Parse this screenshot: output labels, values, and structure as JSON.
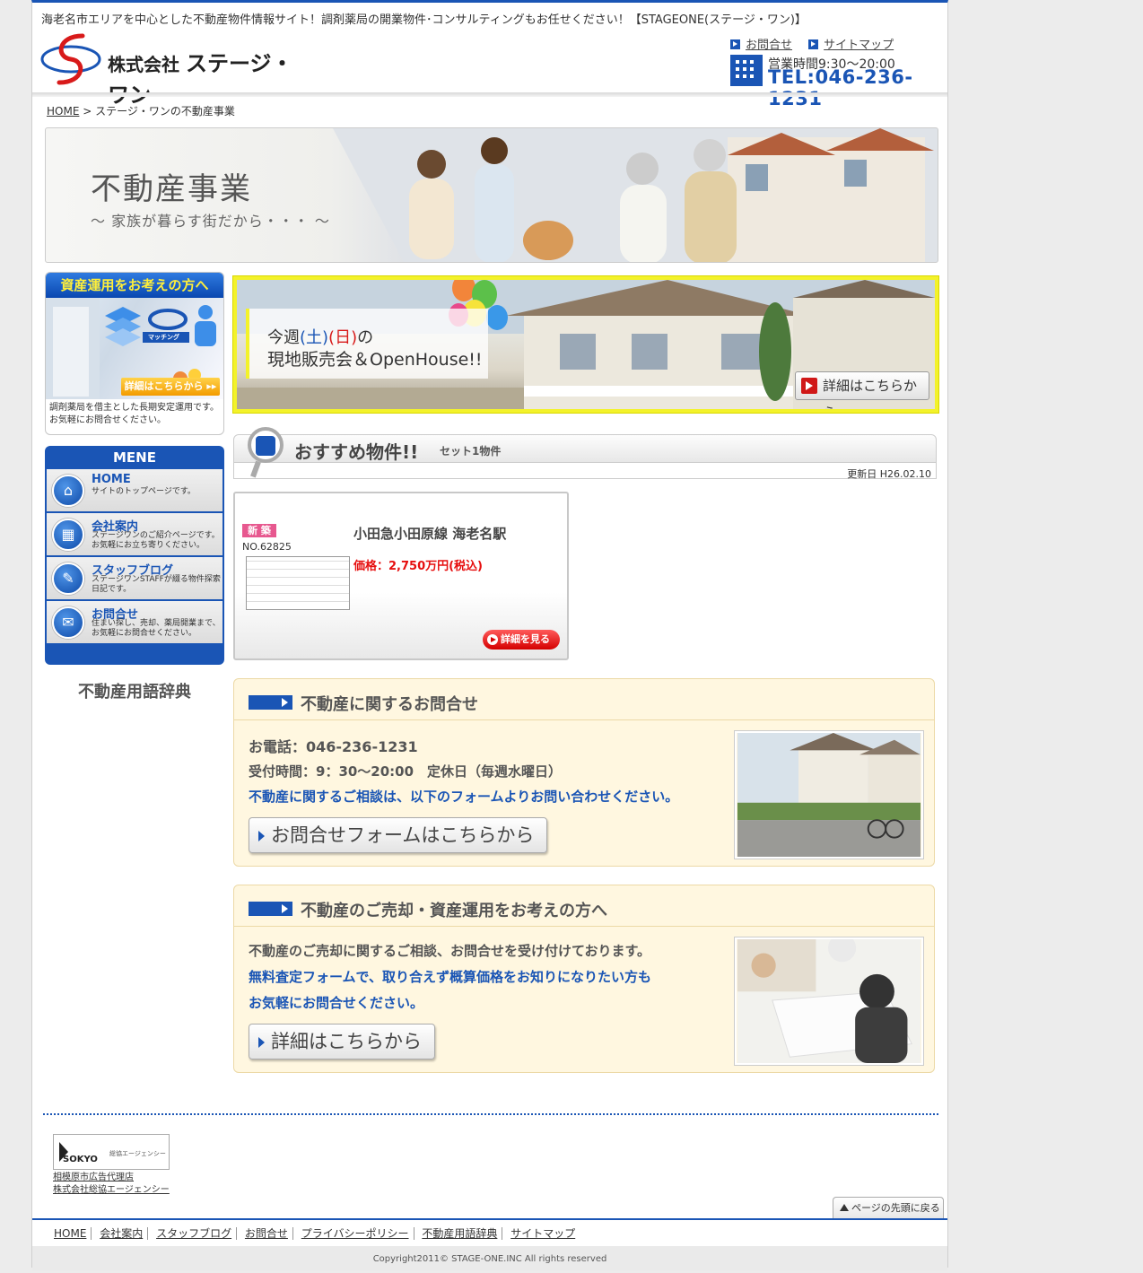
{
  "header": {
    "tagline": "海老名市エリアを中心とした不動産物件情報サイト！調剤薬局の開業物件･コンサルティングもお任せください！【STAGEONE(ステージ・ワン)】",
    "company_prefix": "株式会社",
    "company_name": "ステージ・ワン",
    "links": [
      {
        "label": "お問合せ"
      },
      {
        "label": "サイトマップ"
      }
    ],
    "hours": "営業時間9:30〜20:00",
    "tel": "TEL:046-236-1231"
  },
  "breadcrumb": {
    "home": "HOME",
    "separator": ">",
    "current": "ステージ・ワンの不動産事業"
  },
  "banner": {
    "title": "不動産事業",
    "subtitle": "〜 家族が暮らす街だから・・・ 〜"
  },
  "sidebar": {
    "ad_title": "資産運用をお考えの方へ",
    "ad_badge": "マッチング",
    "ad_button": "詳細はこちらから ▸▸",
    "ad_text": "調剤薬局を借主とした長期安定運用です。お気軽にお問合せください。",
    "menu_title": "MENE",
    "menu_items": [
      {
        "title": "HOME",
        "desc": "サイトのトップページです。",
        "icon": "home-icon"
      },
      {
        "title": "会社案内",
        "desc": "ステージワンのご紹介ページです。お気軽にお立ち寄りください。",
        "icon": "building-icon"
      },
      {
        "title": "スタッフブログ",
        "desc": "ステージワンSTAFFが綴る物件探索日記です。",
        "icon": "pen-note-icon"
      },
      {
        "title": "お問合せ",
        "desc": "住まい探し、売却、薬局開業まで、お気軽にお問合せください。",
        "icon": "mail-icon"
      }
    ],
    "dictionary": "不動産用語辞典"
  },
  "openhouse": {
    "line1_pre": "今週",
    "sat": "(土)",
    "sun": "(日)",
    "line1_post": "の",
    "line2": "現地販売会＆OpenHouse!!",
    "button": "詳細はこちらから"
  },
  "recommended": {
    "title": "おすすめ物件!!",
    "count": "セット1物件",
    "updated": "更新日 H26.02.10",
    "listing": {
      "badge": "新 築",
      "number": "NO.62825",
      "line": "小田急小田原線 海老名駅",
      "price": "価格：2,750万円(税込)",
      "button": "詳細を見る"
    }
  },
  "inquiry": {
    "title": "不動産に関するお問合せ",
    "phone": "お電話：046-236-1231",
    "hours": "受付時間：9：30〜20:00　定休日（毎週水曜日）",
    "note": "不動産に関するご相談は、以下のフォームよりお問い合わせください。",
    "button": "お問合せフォームはこちらから"
  },
  "sell": {
    "title": "不動産のご売却・資産運用をお考えの方へ",
    "line1": "不動産のご売却に関するご相談、お問合せを受け付けております。",
    "line2": "無料査定フォームで、取り合えず概算価格をお知りになりたい方も",
    "line3": "お気軽にお問合せください。",
    "button": "詳細はこちらから"
  },
  "footer": {
    "partner_logo": "SOKYO",
    "partner_logo_sub": "総協エージェンシー",
    "partner_line1": "相模原市広告代理店",
    "partner_line2": "株式会社総協エージェンシー",
    "pagetop": "ページの先頭に戻る",
    "nav": [
      "HOME",
      "会社案内",
      "スタッフブログ",
      "お問合せ",
      "プライバシーポリシー",
      "不動産用語辞典",
      "サイトマップ"
    ],
    "copyright": "Copyright2011© STAGE-ONE.INC All rights reserved"
  },
  "colors": {
    "brand_blue": "#1a55b5",
    "accent_red": "#e60f0f",
    "highlight_yellow": "#f3f22a"
  }
}
